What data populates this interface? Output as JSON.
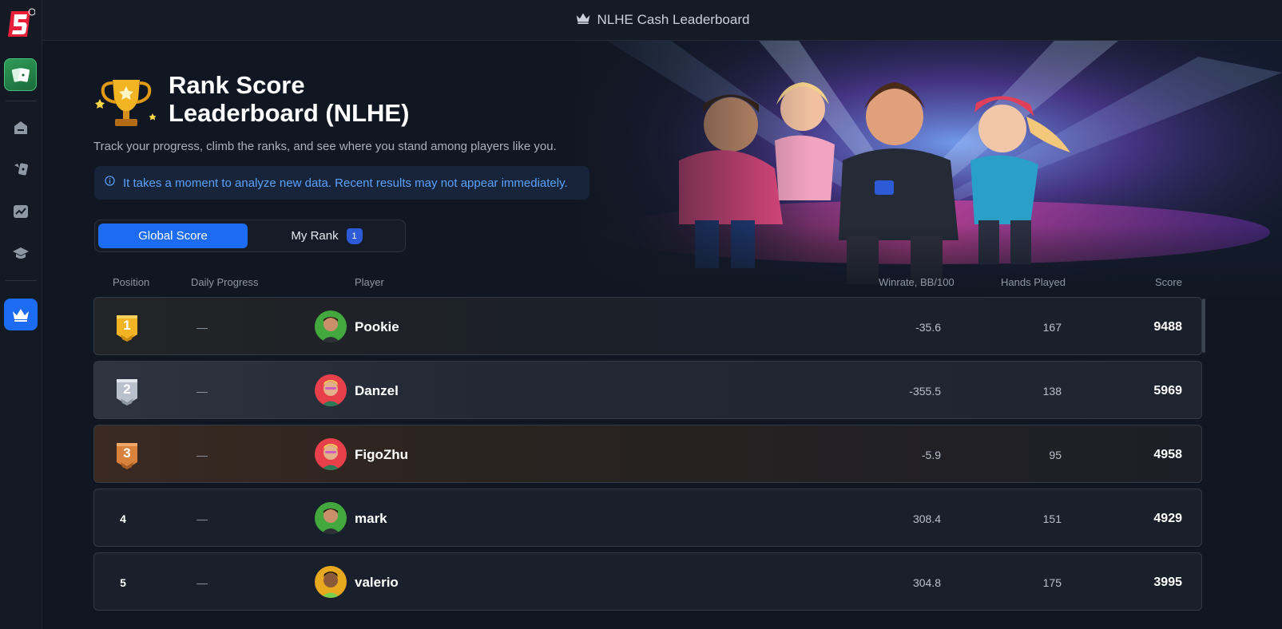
{
  "topbar": {
    "title": "NLHE Cash Leaderboard",
    "icon": "crown-icon"
  },
  "sidebar": {
    "logo": "5",
    "items": [
      {
        "name": "home",
        "icon": "home-icon"
      },
      {
        "name": "play",
        "icon": "cards-icon"
      },
      {
        "name": "stats",
        "icon": "chart-icon"
      },
      {
        "name": "learn",
        "icon": "graduation-cap-icon"
      },
      {
        "name": "leaderboard",
        "icon": "crown-icon",
        "active": true
      }
    ]
  },
  "hero": {
    "title": "Rank Score Leaderboard (NLHE)",
    "subtitle": "Track your progress, climb the ranks, and see where you stand among players like you.",
    "info": "It takes a moment to analyze new data. Recent results may not appear immediately."
  },
  "tabs": {
    "global_label": "Global Score",
    "myrank_label": "My Rank",
    "myrank_badge": "1"
  },
  "table": {
    "headers": {
      "position": "Position",
      "daily": "Daily Progress",
      "player": "Player",
      "winrate": "Winrate, BB/100",
      "hands": "Hands Played",
      "score": "Score"
    },
    "rows": [
      {
        "position": "1",
        "daily": "—",
        "player": "Pookie",
        "winrate": "-35.6",
        "hands": "167",
        "score": "9488"
      },
      {
        "position": "2",
        "daily": "—",
        "player": "Danzel",
        "winrate": "-355.5",
        "hands": "138",
        "score": "5969"
      },
      {
        "position": "3",
        "daily": "—",
        "player": "FigoZhu",
        "winrate": "-5.9",
        "hands": "95",
        "score": "4958"
      },
      {
        "position": "4",
        "daily": "—",
        "player": "mark",
        "winrate": "308.4",
        "hands": "151",
        "score": "4929"
      },
      {
        "position": "5",
        "daily": "—",
        "player": "valerio",
        "winrate": "304.8",
        "hands": "175",
        "score": "3995"
      }
    ]
  },
  "colors": {
    "accent": "#1b6cf2",
    "gold": "#f2b422",
    "silver": "#c6ccd6",
    "bronze": "#d9823c"
  }
}
